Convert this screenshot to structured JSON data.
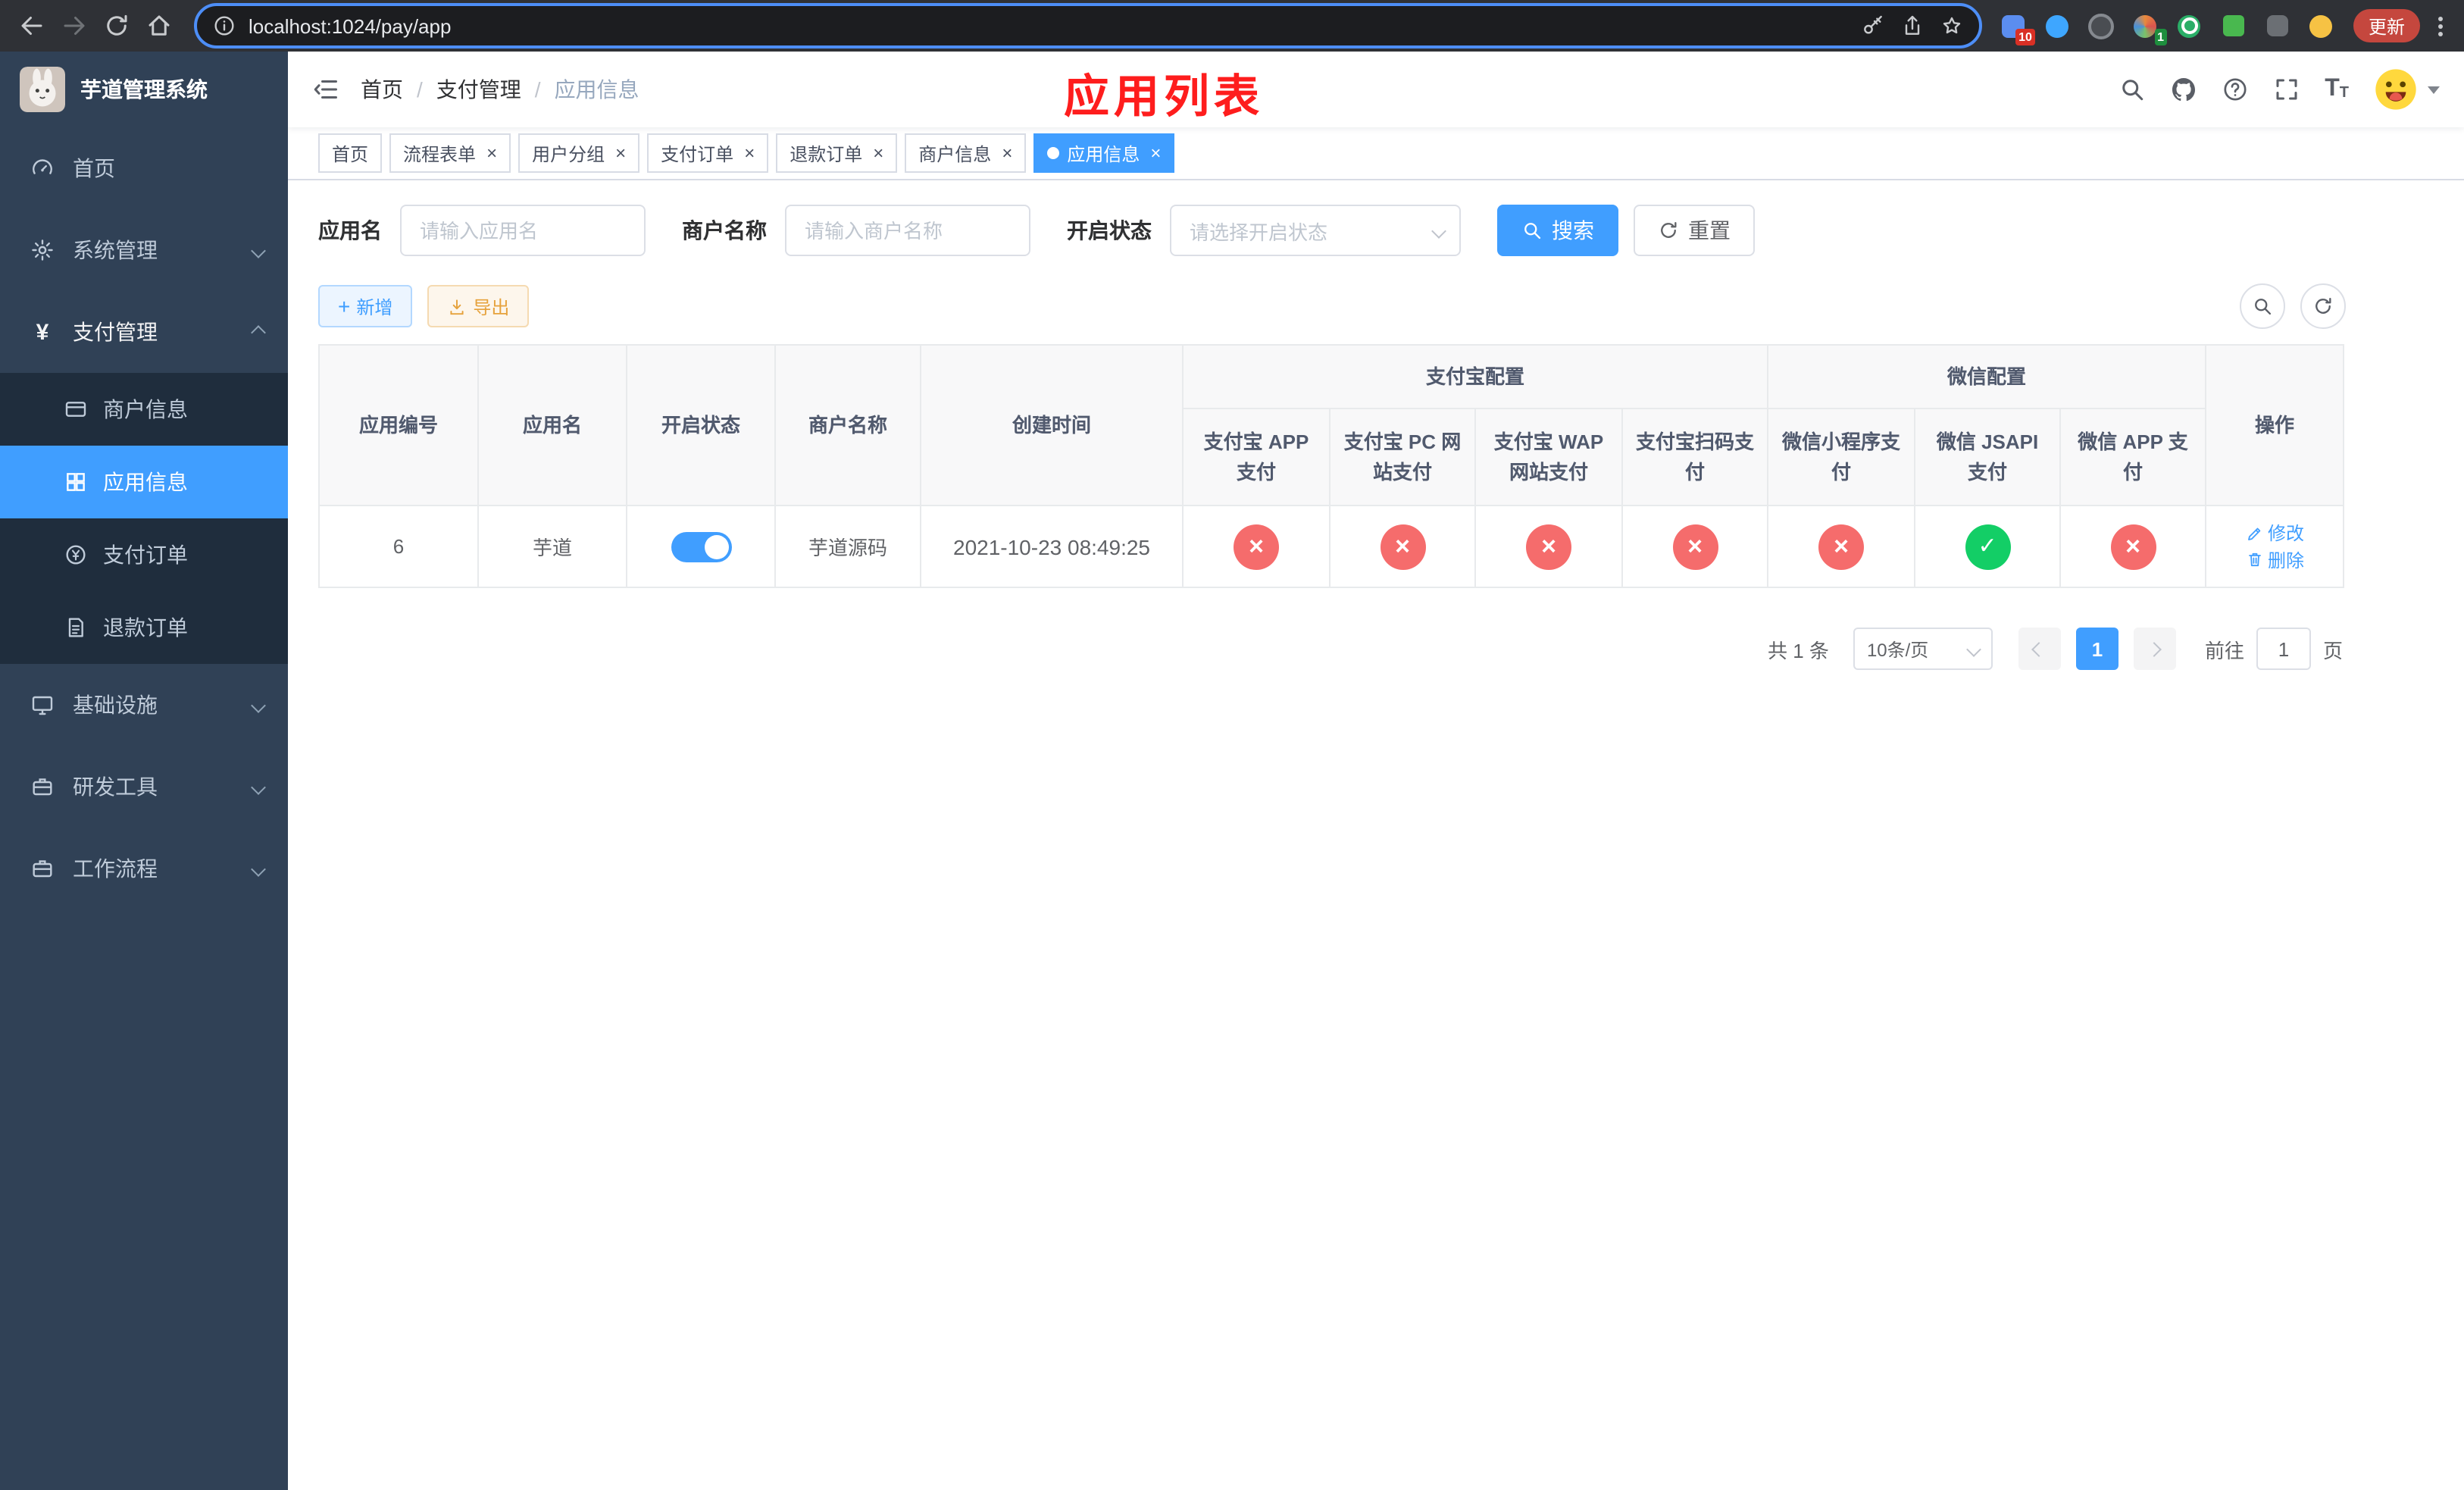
{
  "browser": {
    "url": "localhost:1024/pay/app",
    "update_label": "更新",
    "ext_badge_puzzle": "10",
    "ext_badge_profile": "1"
  },
  "sidebar": {
    "title": "芋道管理系统",
    "items": [
      {
        "label": "首页"
      },
      {
        "label": "系统管理"
      },
      {
        "label": "支付管理"
      },
      {
        "label": "基础设施"
      },
      {
        "label": "研发工具"
      },
      {
        "label": "工作流程"
      }
    ],
    "submenu": [
      {
        "label": "商户信息"
      },
      {
        "label": "应用信息"
      },
      {
        "label": "支付订单"
      },
      {
        "label": "退款订单"
      }
    ]
  },
  "header": {
    "breadcrumb": [
      "首页",
      "支付管理",
      "应用信息"
    ],
    "annotation": "应用列表"
  },
  "tabs": [
    {
      "label": "首页"
    },
    {
      "label": "流程表单"
    },
    {
      "label": "用户分组"
    },
    {
      "label": "支付订单"
    },
    {
      "label": "退款订单"
    },
    {
      "label": "商户信息"
    },
    {
      "label": "应用信息"
    }
  ],
  "filters": {
    "app_name_label": "应用名",
    "app_name_placeholder": "请输入应用名",
    "merchant_label": "商户名称",
    "merchant_placeholder": "请输入商户名称",
    "status_label": "开启状态",
    "status_placeholder": "请选择开启状态",
    "search_label": "搜索",
    "reset_label": "重置"
  },
  "toolbar": {
    "add_label": "新增",
    "export_label": "导出"
  },
  "table": {
    "col_headers": [
      "应用编号",
      "应用名",
      "开启状态",
      "商户名称",
      "创建时间"
    ],
    "group_alipay": "支付宝配置",
    "group_wechat": "微信配置",
    "sub_headers": [
      "支付宝 APP 支付",
      "支付宝 PC 网站支付",
      "支付宝 WAP 网站支付",
      "支付宝扫码支付",
      "微信小程序支付",
      "微信 JSAPI 支付",
      "微信 APP 支付"
    ],
    "op_header": "操作",
    "rows": [
      {
        "id": "6",
        "name": "芋道",
        "enabled": true,
        "merchant": "芋道源码",
        "created": "2021-10-23 08:49:25",
        "statuses": [
          "no",
          "no",
          "no",
          "no",
          "no",
          "yes",
          "no"
        ],
        "actions": [
          "修改",
          "删除"
        ]
      }
    ]
  },
  "pagination": {
    "total": "共 1 条",
    "page_size": "10条/页",
    "current_page": "1",
    "goto_label": "前往",
    "goto_value": "1",
    "page_unit": "页"
  },
  "colors": {
    "primary": "#409eff",
    "danger": "#f56c6c",
    "success": "#13ce66",
    "warning": "#e6a23c",
    "annotation_red": "#fe1d1d"
  }
}
